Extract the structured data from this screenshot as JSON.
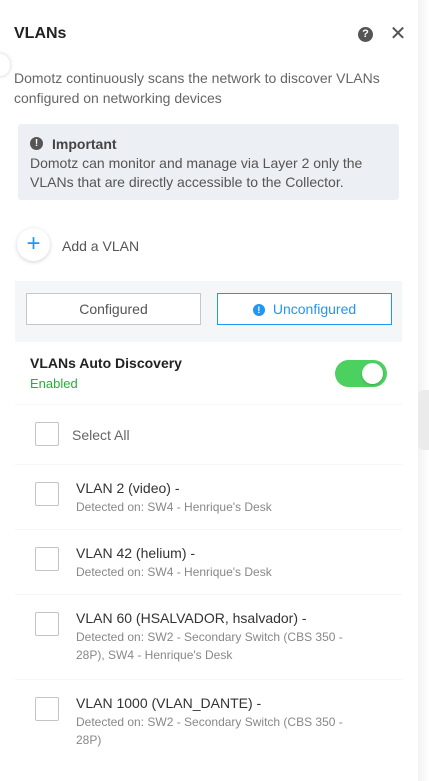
{
  "header": {
    "title": "VLANs",
    "help_glyph": "?",
    "close_glyph": "✕"
  },
  "description": "Domotz continuously scans the network to discover VLANs configured on networking devices",
  "alert": {
    "icon_glyph": "!",
    "title": "Important",
    "body": "Domotz can monitor and manage via Layer 2 only the VLANs that are directly accessible to the Collector."
  },
  "add_vlan": {
    "icon_glyph": "+",
    "label": "Add a VLAN"
  },
  "filters": {
    "configured_label": "Configured",
    "unconfigured_label": "Unconfigured",
    "unconfigured_icon_glyph": "!",
    "active": "Unconfigured"
  },
  "auto_discovery": {
    "title": "VLANs Auto Discovery",
    "status": "Enabled",
    "enabled": true
  },
  "select_all_label": "Select All",
  "vlans": [
    {
      "name": "VLAN 2 (video) -",
      "detected": "Detected on: SW4 - Henrique's Desk"
    },
    {
      "name": "VLAN 42 (helium) -",
      "detected": "Detected on: SW4 - Henrique's Desk"
    },
    {
      "name": "VLAN 60 (HSALVADOR, hsalvador) -",
      "detected": "Detected on: SW2 - Secondary Switch (CBS 350 - 28P), SW4 - Henrique's Desk"
    },
    {
      "name": "VLAN 1000 (VLAN_DANTE) -",
      "detected": "Detected on: SW2 - Secondary Switch (CBS 350 - 28P)"
    }
  ],
  "colors": {
    "accent": "#2196f3",
    "enabled": "#1db530",
    "toggle_on": "#4cd060"
  }
}
